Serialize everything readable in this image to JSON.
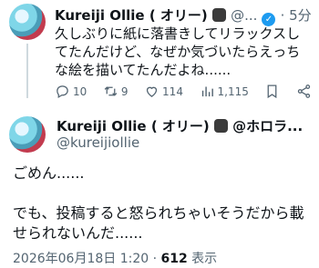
{
  "reply_tweet": {
    "display_name": "Kureiji Ollie ( オリー) ",
    "handle": "@...",
    "time": "· 5分",
    "text": "久しぶりに紙に落書きしてリラックスしてたんだけど、なぜか気づいたらえっちな絵を描いてたんだよね......",
    "actions": {
      "replies": "10",
      "retweets": "9",
      "likes": "114",
      "views": "1,115"
    }
  },
  "main_tweet": {
    "display_name": "Kureiji Ollie ( オリー) ",
    "affiliation": "@ホロラ...",
    "handle": "@kureijiollie",
    "text_1": "ごめん......",
    "text_2": "でも、投稿すると怒られちゃいそうだから載せられないんだ......",
    "date": "2026年06月18日 1:20 · ",
    "views_count": "612",
    "views_label": " 表示"
  },
  "icons": [
    "reply-icon",
    "retweet-icon",
    "like-icon",
    "views-icon",
    "bookmark-icon",
    "share-icon",
    "verified-icon",
    "more-icon"
  ],
  "colors": {
    "accent": "#1d9bf0",
    "muted": "#536471",
    "text": "#0f1419"
  }
}
